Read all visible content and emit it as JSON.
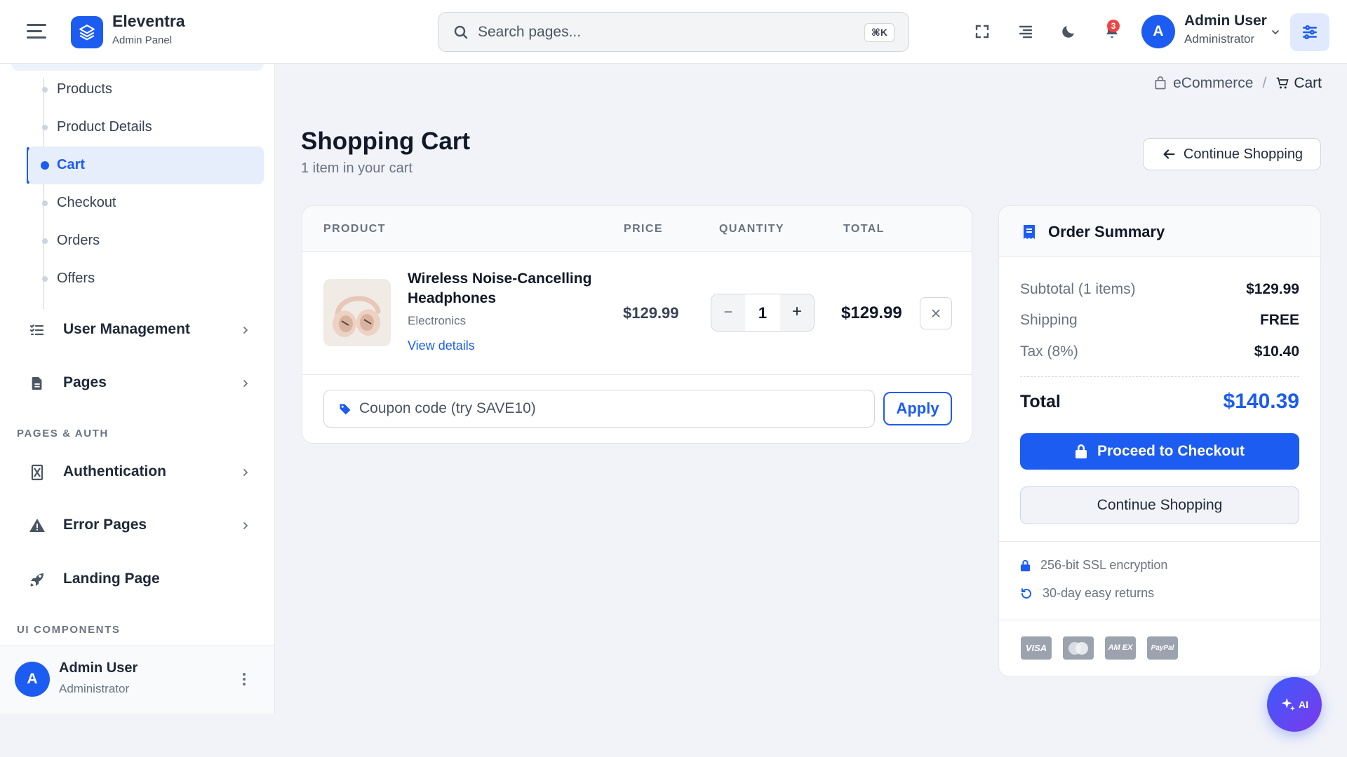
{
  "brand": {
    "name": "Eleventra",
    "subtitle": "Admin Panel",
    "accent": "#1d5cf0"
  },
  "search": {
    "placeholder": "Search pages...",
    "shortcut": "⌘K"
  },
  "header": {
    "notification_count": "3",
    "user": {
      "initial": "A",
      "name": "Admin User",
      "role": "Administrator"
    }
  },
  "sidebar": {
    "sub_items": [
      {
        "label": "Products"
      },
      {
        "label": "Product Details"
      },
      {
        "label": "Cart"
      },
      {
        "label": "Checkout"
      },
      {
        "label": "Orders"
      },
      {
        "label": "Offers"
      }
    ],
    "nav_items": [
      {
        "label": "User Management",
        "icon": "list-check-icon"
      },
      {
        "label": "Pages",
        "icon": "file-icon"
      }
    ],
    "section_pages_auth": "PAGES & AUTH",
    "auth_items": [
      {
        "label": "Authentication",
        "icon": "hourglass-icon"
      },
      {
        "label": "Error Pages",
        "icon": "warning-icon"
      },
      {
        "label": "Landing Page",
        "icon": "rocket-icon"
      }
    ],
    "section_ui": "UI COMPONENTS",
    "user": {
      "initial": "A",
      "name": "Admin User",
      "role": "Administrator"
    }
  },
  "breadcrumb": {
    "parent": "eCommerce",
    "separator": "/",
    "current": "Cart"
  },
  "page": {
    "title": "Shopping Cart",
    "subtitle": "1 item in your cart",
    "continue_label": "Continue Shopping"
  },
  "cart": {
    "columns": {
      "product": "PRODUCT",
      "price": "PRICE",
      "quantity": "QUANTITY",
      "total": "TOTAL"
    },
    "items": [
      {
        "name": "Wireless Noise-Cancelling Headphones",
        "category": "Electronics",
        "link": "View details",
        "price": "$129.99",
        "quantity": "1",
        "total": "$129.99"
      }
    ],
    "coupon_placeholder": "Coupon code (try SAVE10)",
    "apply_label": "Apply"
  },
  "summary": {
    "title": "Order Summary",
    "rows": [
      {
        "label": "Subtotal (1 items)",
        "value": "$129.99"
      },
      {
        "label": "Shipping",
        "value": "FREE"
      },
      {
        "label": "Tax (8%)",
        "value": "$10.40"
      }
    ],
    "total_label": "Total",
    "total_value": "$140.39",
    "checkout_label": "Proceed to Checkout",
    "continue_label": "Continue Shopping",
    "trust": [
      {
        "label": "256-bit SSL encryption",
        "icon": "lock-icon"
      },
      {
        "label": "30-day easy returns",
        "icon": "rotate-icon"
      }
    ],
    "payments": [
      {
        "label": "VISA",
        "icon": "visa-icon"
      },
      {
        "label": "",
        "icon": "mastercard-icon"
      },
      {
        "label": "AM EX",
        "icon": "amex-icon"
      },
      {
        "label": "PayPal",
        "icon": "paypal-icon"
      }
    ]
  },
  "ai_button": {
    "label": "AI"
  }
}
